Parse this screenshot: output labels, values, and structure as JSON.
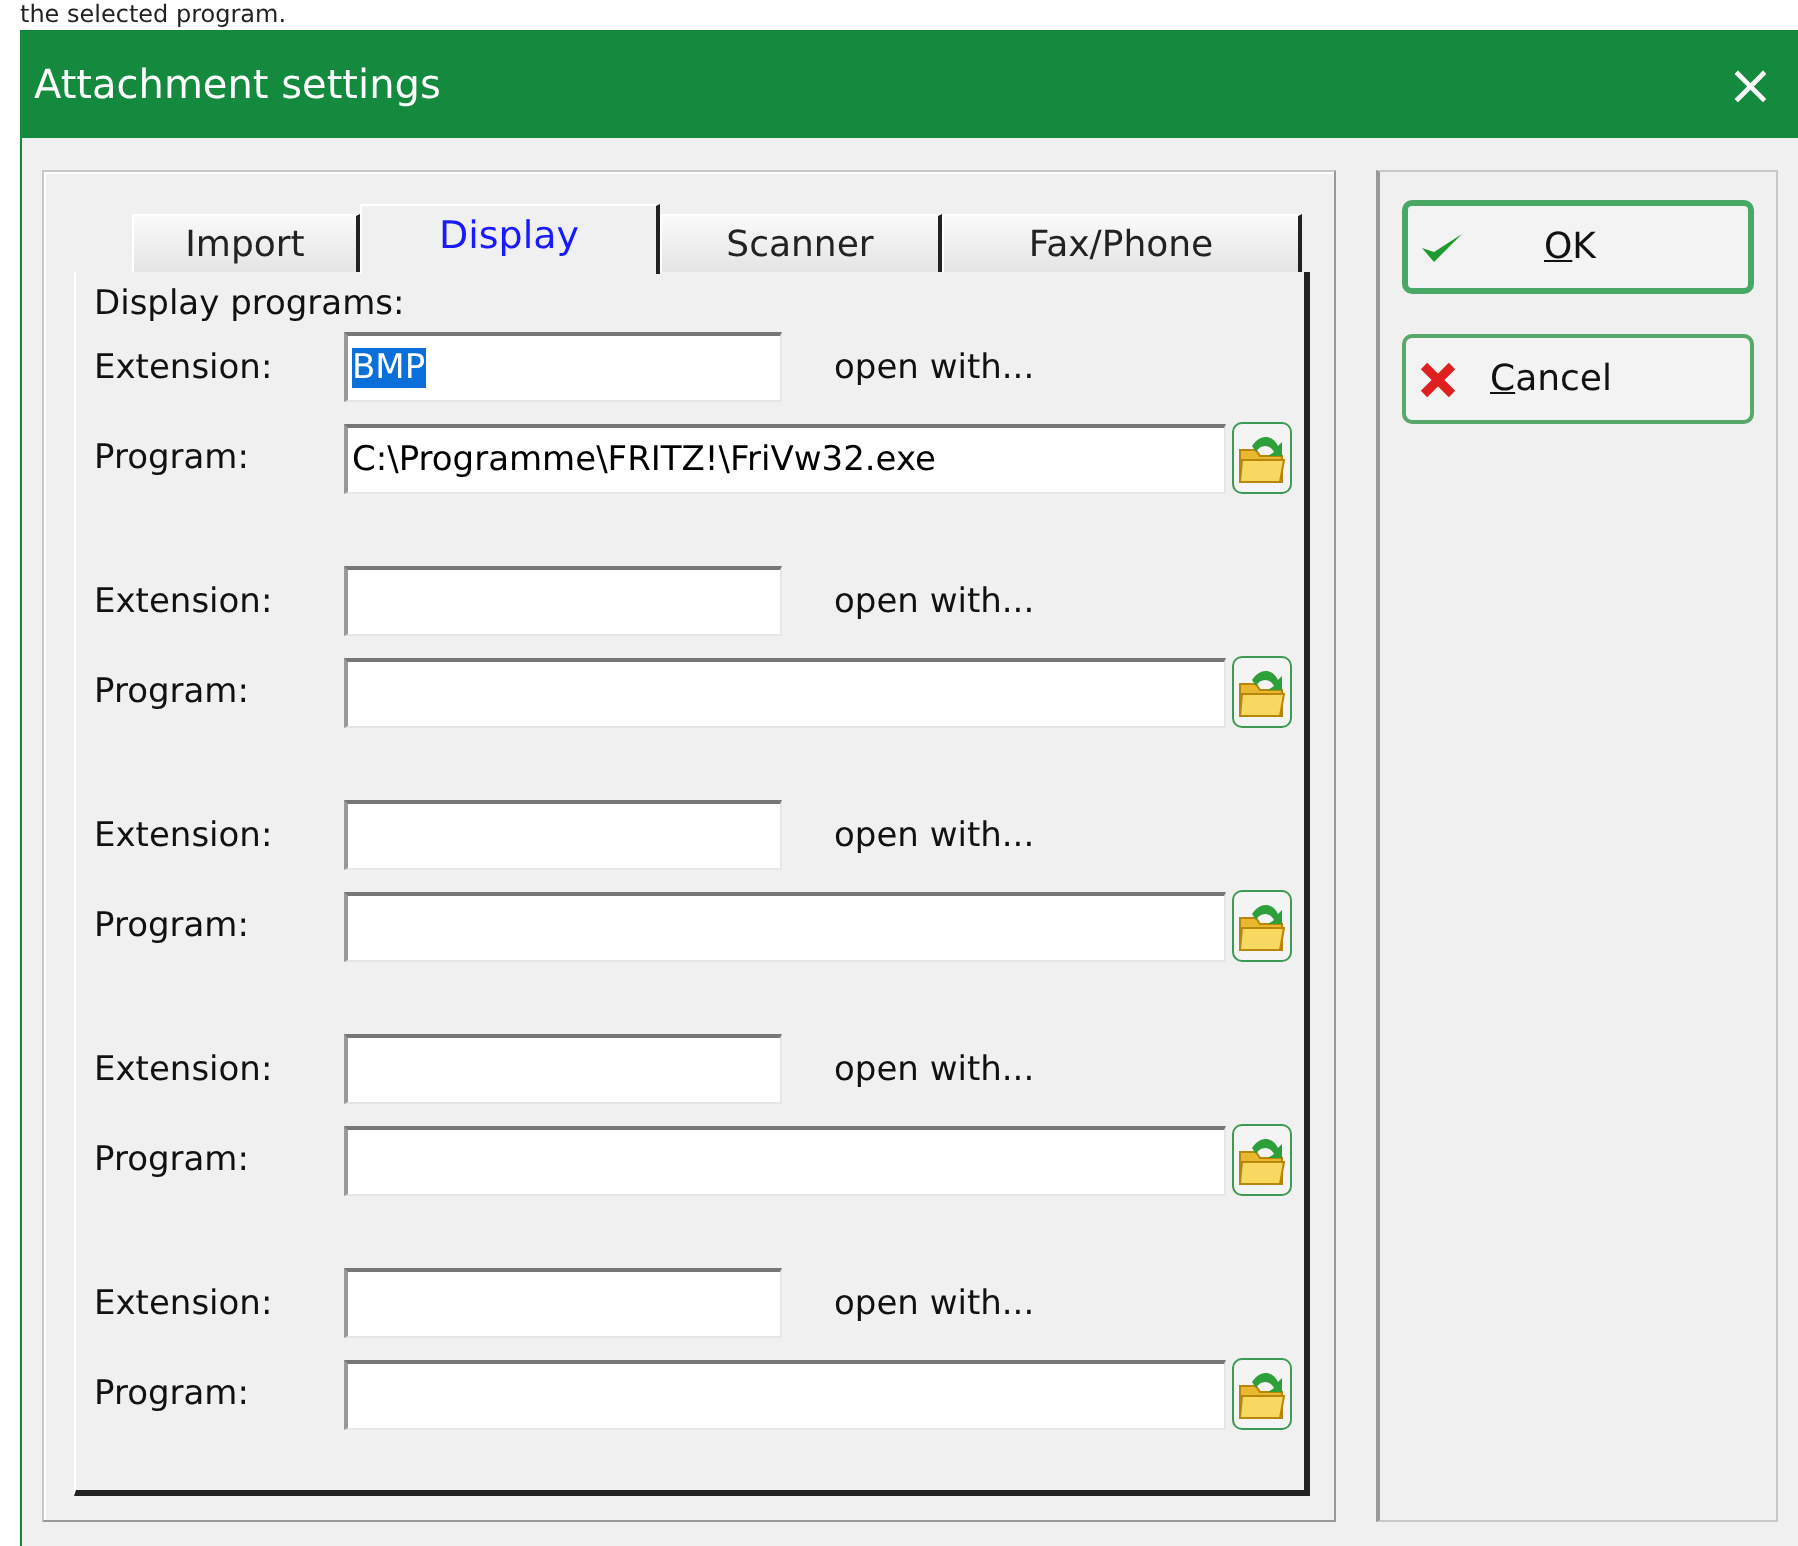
{
  "caption_fragment": "the selected program.",
  "window": {
    "title": "Attachment settings",
    "close": "×"
  },
  "tabs": [
    {
      "label": "Import",
      "selected": false
    },
    {
      "label": "Display",
      "selected": true
    },
    {
      "label": "Scanner",
      "selected": false
    },
    {
      "label": "Fax/Phone",
      "selected": false
    }
  ],
  "section_label": "Display programs:",
  "entries": [
    {
      "extension_label": "Extension:",
      "extension": "BMP",
      "text_selected": true,
      "open_with": "open with...",
      "program_label": "Program:",
      "program": "C:\\Programme\\FRITZ!\\FriVw32.exe"
    },
    {
      "extension_label": "Extension:",
      "text_selected": false,
      "open_with": "open with...",
      "program_label": "Program:"
    },
    {
      "extension_label": "Extension:",
      "text_selected": false,
      "open_with": "open with...",
      "program_label": "Program:"
    },
    {
      "extension_label": "Extension:",
      "text_selected": false,
      "open_with": "open with...",
      "program_label": "Program:"
    },
    {
      "extension_label": "Extension:",
      "text_selected": false,
      "open_with": "open with...",
      "program_label": "Program:"
    }
  ],
  "buttons": [
    {
      "label": "OK",
      "kind": "ok",
      "default": true
    },
    {
      "label": "Cancel",
      "kind": "cancel",
      "default": false
    }
  ]
}
